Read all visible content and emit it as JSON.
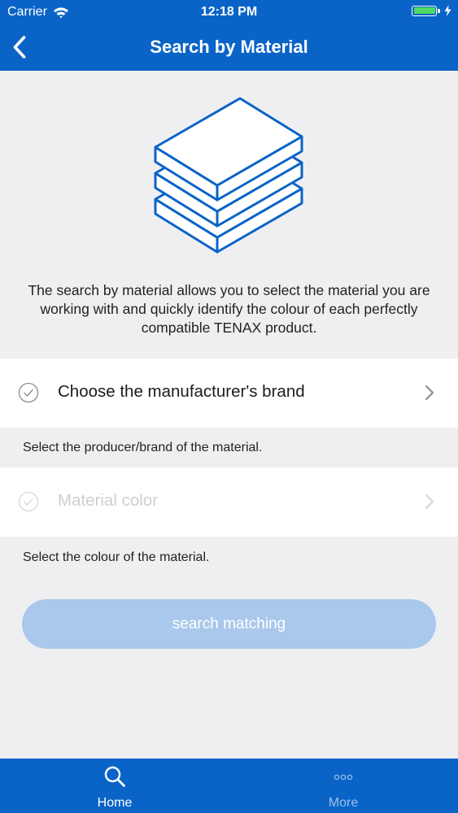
{
  "status_bar": {
    "carrier": "Carrier",
    "time": "12:18 PM",
    "battery_color": "#4cd964"
  },
  "nav": {
    "title": "Search by Material",
    "back_icon": "chevron-left-icon"
  },
  "brand_color": "#0a64c8",
  "illustration_icon": "layers-icon",
  "intro_text": "The search by material  allows you to select the material you are working with and quickly identify the colour of each perfectly compatible TENAX product.",
  "rows": [
    {
      "label": "Choose the manufacturer's brand",
      "hint": "Select the producer/brand of the material.",
      "enabled": true
    },
    {
      "label": "Material color",
      "hint": "Select the colour of the material.",
      "enabled": false
    }
  ],
  "search_button": {
    "label": "search matching",
    "color": "#a9c8eb"
  },
  "tabs": [
    {
      "label": "Home",
      "icon": "search-icon",
      "active": true
    },
    {
      "label": "More",
      "icon": "more-icon",
      "active": false
    }
  ]
}
